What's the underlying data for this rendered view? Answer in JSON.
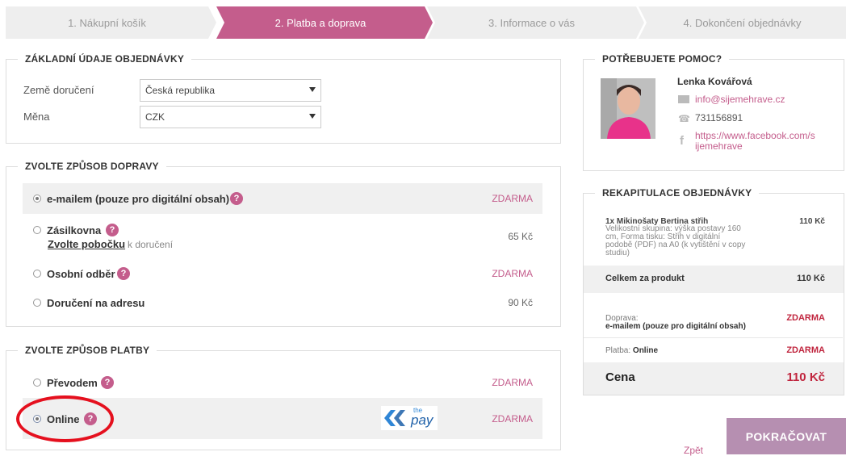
{
  "steps": [
    {
      "label": "1. Nákupní košík",
      "active": false
    },
    {
      "label": "2. Platba a doprava",
      "active": true
    },
    {
      "label": "3. Informace o vás",
      "active": false
    },
    {
      "label": "4. Dokončení objednávky",
      "active": false
    }
  ],
  "basic": {
    "title": "ZÁKLADNÍ ÚDAJE OBJEDNÁVKY",
    "country_label": "Země doručení",
    "country_value": "Česká republika",
    "currency_label": "Měna",
    "currency_value": "CZK"
  },
  "shipping": {
    "title": "ZVOLTE ZPŮSOB DOPRAVY",
    "options": [
      {
        "label": "e-mailem (pouze pro digitální obsah)",
        "price": "ZDARMA",
        "selected": true
      },
      {
        "label": "Zásilkovna",
        "link": "Zvolte pobočku",
        "sub": "k doručení",
        "price": "65 Kč",
        "selected": false
      },
      {
        "label": "Osobní odběr",
        "price": "ZDARMA",
        "selected": false
      },
      {
        "label": "Doručení na adresu",
        "price": "90 Kč",
        "selected": false
      }
    ]
  },
  "payment": {
    "title": "ZVOLTE ZPŮSOB PLATBY",
    "options": [
      {
        "label": "Převodem",
        "price": "ZDARMA",
        "selected": false
      },
      {
        "label": "Online",
        "price": "ZDARMA",
        "selected": true,
        "logo_small": "the",
        "logo_big": "pay"
      }
    ]
  },
  "help": {
    "title": "POTŘEBUJETE POMOC?",
    "name": "Lenka Kovářová",
    "email": "info@sijemehrave.cz",
    "phone": "731156891",
    "facebook_line1": "https://www.facebook.com/s",
    "facebook_line2": "ijemehrave"
  },
  "summary": {
    "title": "REKAPITULACE OBJEDNÁVKY",
    "item_name": "1x Mikinošaty Bertina střih",
    "item_price": "110 Kč",
    "item_desc": [
      "Velikostní skupina: výška postavy 160",
      "cm, Forma tisku: Střih v digitální",
      "podobě (PDF) na A0 (k vytištění v copy",
      "studiu)"
    ],
    "product_total_label": "Celkem za produkt",
    "product_total_value": "110 Kč",
    "shipping_label": "Doprava:",
    "shipping_value": "e-mailem (pouze pro digitální obsah)",
    "shipping_price": "ZDARMA",
    "payment_label": "Platba:",
    "payment_value": "Online",
    "payment_price": "ZDARMA",
    "total_label": "Cena",
    "total_value": "110 Kč"
  },
  "actions": {
    "back": "Zpět",
    "continue": "POKRAČOVAT"
  },
  "colors": {
    "accent": "#c45d8c",
    "price_red": "#c0253e",
    "button": "#b68fb1",
    "highlight_circle": "#e5101e"
  }
}
